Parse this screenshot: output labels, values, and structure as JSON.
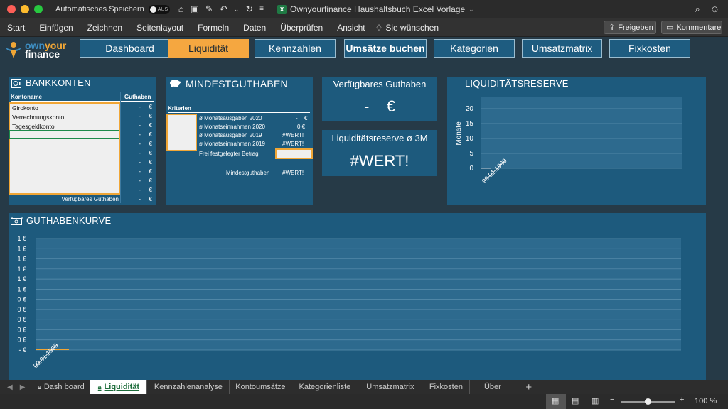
{
  "titlebar": {
    "autosave_label": "Automatisches Speichern",
    "autosave_state": "AUS",
    "document_title": "Ownyourfinance Haushaltsbuch Excel Vorlage"
  },
  "ribbon": {
    "menu": [
      "Start",
      "Einfügen",
      "Zeichnen",
      "Seitenlayout",
      "Formeln",
      "Daten",
      "Überprüfen",
      "Ansicht"
    ],
    "tell_me": "Sie wünschen",
    "share_label": "Freigeben",
    "comments_label": "Kommentare"
  },
  "logo": {
    "own": "own",
    "your": "your",
    "finance": "finance"
  },
  "nav": [
    {
      "label": "Dashboard"
    },
    {
      "label": "Liquidität"
    },
    {
      "label": "Kennzahlen"
    },
    {
      "label": "Umsätze buchen"
    },
    {
      "label": "Kategorien"
    },
    {
      "label": "Umsatzmatrix"
    },
    {
      "label": "Fixkosten"
    }
  ],
  "bankkonten": {
    "title": "BANKKONTEN",
    "col_name": "Kontoname",
    "col_balance": "Guthaben",
    "accounts": [
      "Girokonto",
      "Verrechnungskonto",
      "Tagesgeldkonto"
    ],
    "empty_value": "-",
    "currency": "€",
    "total_label": "Verfügbares Guthaben"
  },
  "mindestguthaben": {
    "title": "MINDESTGUTHABEN",
    "criteria_label": "Kriterien",
    "rows": [
      {
        "label": "ø Monatsausgaben 2020",
        "value": "-",
        "unit": "€"
      },
      {
        "label": "ø Monatseinnahmen 2020",
        "value": "0 €",
        "unit": ""
      },
      {
        "label": "ø Monatsausgaben 2019",
        "value": "#WERT!",
        "unit": ""
      },
      {
        "label": "ø Monatseinnahmen 2019",
        "value": "#WERT!",
        "unit": ""
      }
    ],
    "fixed_label": "Frei festgelegter Betrag",
    "result_label": "Mindestguthaben",
    "result_value": "#WERT!"
  },
  "verfuegbar": {
    "title": "Verfügbares Guthaben",
    "value": "-    €"
  },
  "reserve3m": {
    "title": "Liquiditätsreserve ø 3M",
    "value": "#WERT!"
  },
  "reserve_chart_title": "LIQUIDITÄTSRESERVE",
  "guthaben_chart_title": "GUTHABENKURVE",
  "chart_data": [
    {
      "type": "bar",
      "title": "LIQUIDITÄTSRESERVE",
      "ylabel": "Monate",
      "yticks": [
        "20",
        "15",
        "10",
        "5",
        "0"
      ],
      "ylim": [
        0,
        20
      ],
      "categories": [
        "00.01.1900"
      ],
      "values": [
        0
      ],
      "grid": true
    },
    {
      "type": "line",
      "title": "GUTHABENKURVE",
      "yticks": [
        "1 €",
        "1 €",
        "1 €",
        "1 €",
        "1 €",
        "1 €",
        "0 €",
        "0 €",
        "0 €",
        "0 €",
        "0 €",
        "-  €"
      ],
      "categories": [
        "00.01.1900"
      ],
      "values": [
        0
      ],
      "grid": true,
      "color": "#f0a636"
    }
  ],
  "sheet_tabs": [
    {
      "label": "Dash board",
      "locked": true
    },
    {
      "label": "Liquidität",
      "locked": true,
      "active": true
    },
    {
      "label": "Kennzahlenanalyse"
    },
    {
      "label": "Kontoumsätze"
    },
    {
      "label": "Kategorienliste"
    },
    {
      "label": "Umsatzmatrix"
    },
    {
      "label": "Fixkosten"
    },
    {
      "label": "Über"
    }
  ],
  "status": {
    "zoom": "100 %"
  },
  "colors": {
    "panel": "#1d5a7d",
    "background": "#263a47",
    "accent": "#f5a740"
  }
}
